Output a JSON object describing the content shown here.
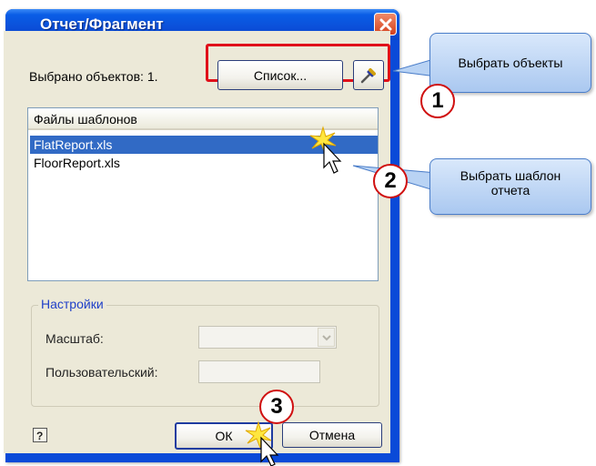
{
  "window": {
    "title": "Отчет/Фрагмент",
    "close_icon": "close-icon"
  },
  "selection": {
    "label": "Выбрано объектов: 1.",
    "list_button": "Список..."
  },
  "templates": {
    "header": "Файлы шаблонов",
    "items": [
      {
        "label": "FlatReport.xls",
        "selected": true
      },
      {
        "label": "FloorReport.xls",
        "selected": false
      }
    ]
  },
  "settings": {
    "group_label": "Настройки",
    "scale_label": "Масштаб:",
    "scale_value": "",
    "custom_label": "Пользовательский:",
    "custom_value": ""
  },
  "footer": {
    "help_icon": "help-icon",
    "ok_label": "ОК",
    "cancel_label": "Отмена"
  },
  "annotations": {
    "callout_1": "Выбрать объекты",
    "callout_2_line1": "Выбрать шаблон",
    "callout_2_line2": "отчета",
    "badge_1": "1",
    "badge_2": "2",
    "badge_3": "3"
  },
  "colors": {
    "accent": "#0a4ad8",
    "selection": "#316ac5",
    "highlight_box": "#e0101a"
  }
}
